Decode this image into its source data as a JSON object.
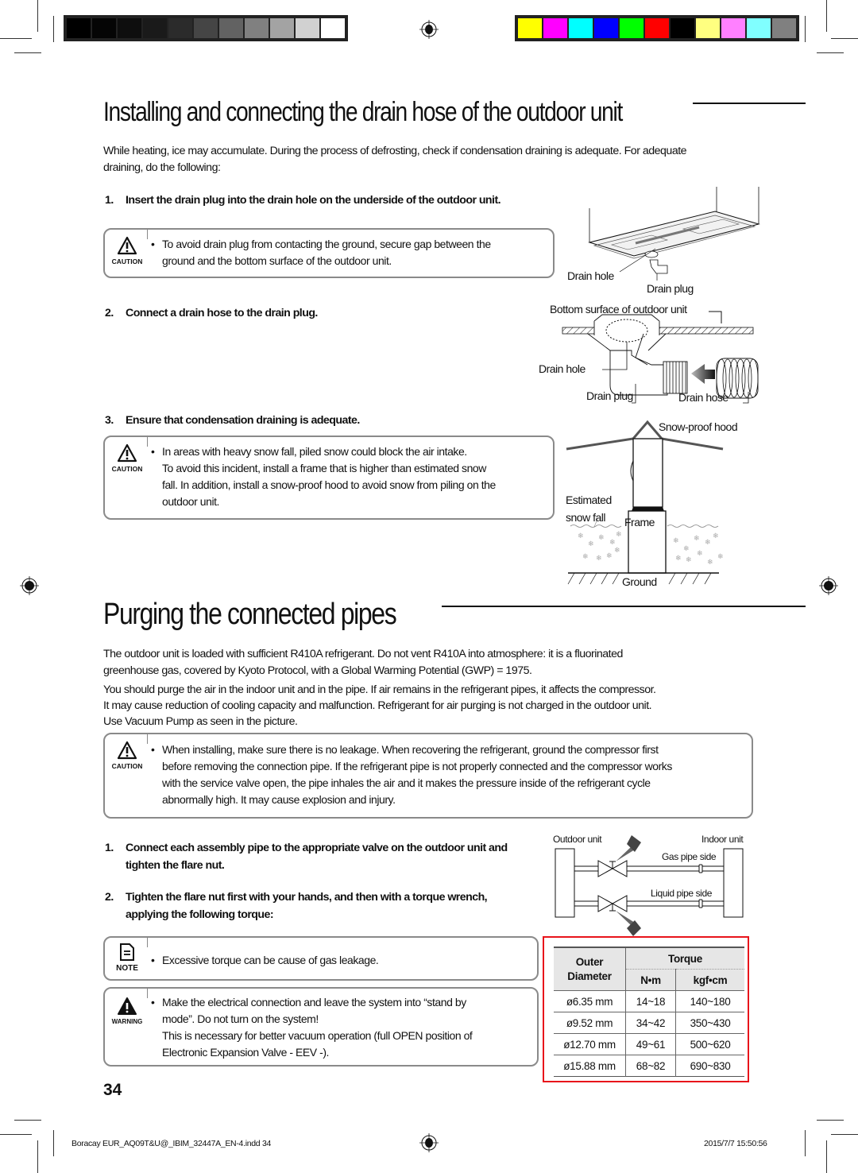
{
  "print_marks": {
    "grayscale_swatches": [
      "#000000",
      "#050505",
      "#0e0e0e",
      "#1a1a1a",
      "#2b2b2b",
      "#454545",
      "#626262",
      "#808080",
      "#a3a3a3",
      "#d1d1d1",
      "#ffffff"
    ],
    "color_swatches": [
      "#ffff00",
      "#ff00ff",
      "#00ffff",
      "#0000ff",
      "#00ff00",
      "#ff0000",
      "#000000",
      "#ffff80",
      "#ff80ff",
      "#80ffff",
      "#808080"
    ]
  },
  "section1": {
    "title": "Installing and connecting the drain hose of the outdoor unit",
    "intro_line1": "While heating, ice may accumulate. During the process of defrosting, check if condensation draining is adequate.  For adequate",
    "intro_line2": "draining, do the following:",
    "step1": {
      "num": "1.",
      "text": "Insert the drain plug into the drain hole on the underside of the outdoor unit."
    },
    "caution1": {
      "icon_label": "CAUTION",
      "bullet": "•",
      "line1": "To avoid drain plug from contacting the ground, secure gap between the",
      "line2": "ground and the bottom surface of the outdoor unit."
    },
    "step2": {
      "num": "2.",
      "text": "Connect a drain hose to the drain plug."
    },
    "step3": {
      "num": "3.",
      "text": "Ensure that condensation draining is adequate."
    },
    "caution2": {
      "icon_label": "CAUTION",
      "bullet": "•",
      "line1": "In areas with heavy snow fall, piled snow could block the air intake.",
      "line2": "To avoid this incident, install a frame that is higher than estimated snow",
      "line3": "fall. In addition, install a snow-proof hood to avoid snow from piling on the",
      "line4": "outdoor unit."
    },
    "figure_unit": {
      "drain_hole": "Drain hole",
      "drain_plug": "Drain plug"
    },
    "figure_cross_section": {
      "bottom_surface": "Bottom surface of outdoor unit",
      "drain_hole": "Drain hole",
      "drain_plug": "Drain plug",
      "drain_hose": "Drain hose"
    },
    "figure_snow": {
      "hood": "Snow-proof hood",
      "estimated_line1": "Estimated",
      "estimated_line2": "snow fall",
      "frame": "Frame",
      "ground": "Ground"
    }
  },
  "section2": {
    "title": "Purging the connected pipes",
    "para1_line1": "The outdoor unit is loaded with sufficient R410A refrigerant.  Do not vent R410A into atmosphere: it is a fluorinated",
    "para1_line2": "greenhouse gas,  covered by Kyoto Protocol, with a Global Warming Potential (GWP) = 1975.",
    "para2_line1": "You should purge the air in the indoor unit and in the pipe. If air remains in the refrigerant pipes, it affects the compressor.",
    "para2_line2": "It may cause reduction of cooling capacity and malfunction. Refrigerant for air purging is not charged in the outdoor unit.",
    "para2_line3": "Use Vacuum Pump as seen in the picture.",
    "caution": {
      "icon_label": "CAUTION",
      "bullet": "•",
      "line1": "When installing, make sure there is no leakage. When recovering the refrigerant, ground the compressor first",
      "line2": "before removing the connection pipe. If the refrigerant pipe is not properly connected and the compressor works",
      "line3": "with the service valve open, the pipe inhales the air and it makes the pressure inside of the refrigerant cycle",
      "line4": "abnormally high. It may cause explosion and injury."
    },
    "step1": {
      "num": "1.",
      "line1": "Connect each assembly pipe to the appropriate valve on the outdoor unit and",
      "line2": "tighten the flare nut."
    },
    "step2": {
      "num": "2.",
      "line1": "Tighten the flare nut first with your hands, and then with a torque wrench,",
      "line2": "applying the following torque:"
    },
    "note": {
      "icon_label": "NOTE",
      "bullet": "•",
      "line1": "Excessive torque can be cause of gas leakage."
    },
    "warning": {
      "icon_label": "WARNING",
      "bullet": "•",
      "line1": "Make the electrical connection and leave the system into “stand by",
      "line2": "mode”. Do not turn on the system!",
      "line3": "This is necessary for better vacuum operation (full OPEN position of",
      "line4": "Electronic Expansion Valve - EEV -)."
    },
    "pipe_figure": {
      "outdoor_unit": "Outdoor unit",
      "indoor_unit": "Indoor unit",
      "gas_side": "Gas pipe side",
      "liquid_side": "Liquid pipe side"
    },
    "torque_table": {
      "highlight_color": "#e8141b",
      "header_outer_line1": "Outer",
      "header_outer_line2": "Diameter",
      "header_torque": "Torque",
      "header_nm": "N•m",
      "header_kgf": "kgf•cm",
      "rows": [
        {
          "diameter": "ø6.35 mm",
          "nm": "14~18",
          "kgf": "140~180"
        },
        {
          "diameter": "ø9.52 mm",
          "nm": "34~42",
          "kgf": "350~430"
        },
        {
          "diameter": "ø12.70 mm",
          "nm": "49~61",
          "kgf": "500~620"
        },
        {
          "diameter": "ø15.88 mm",
          "nm": "68~82",
          "kgf": "690~830"
        }
      ]
    }
  },
  "page_number": "34",
  "footer": {
    "file": "Boracay EUR_AQ09T&U@_IBIM_32447A_EN-4.indd   34",
    "timestamp": "2015/7/7   15:50:56"
  }
}
